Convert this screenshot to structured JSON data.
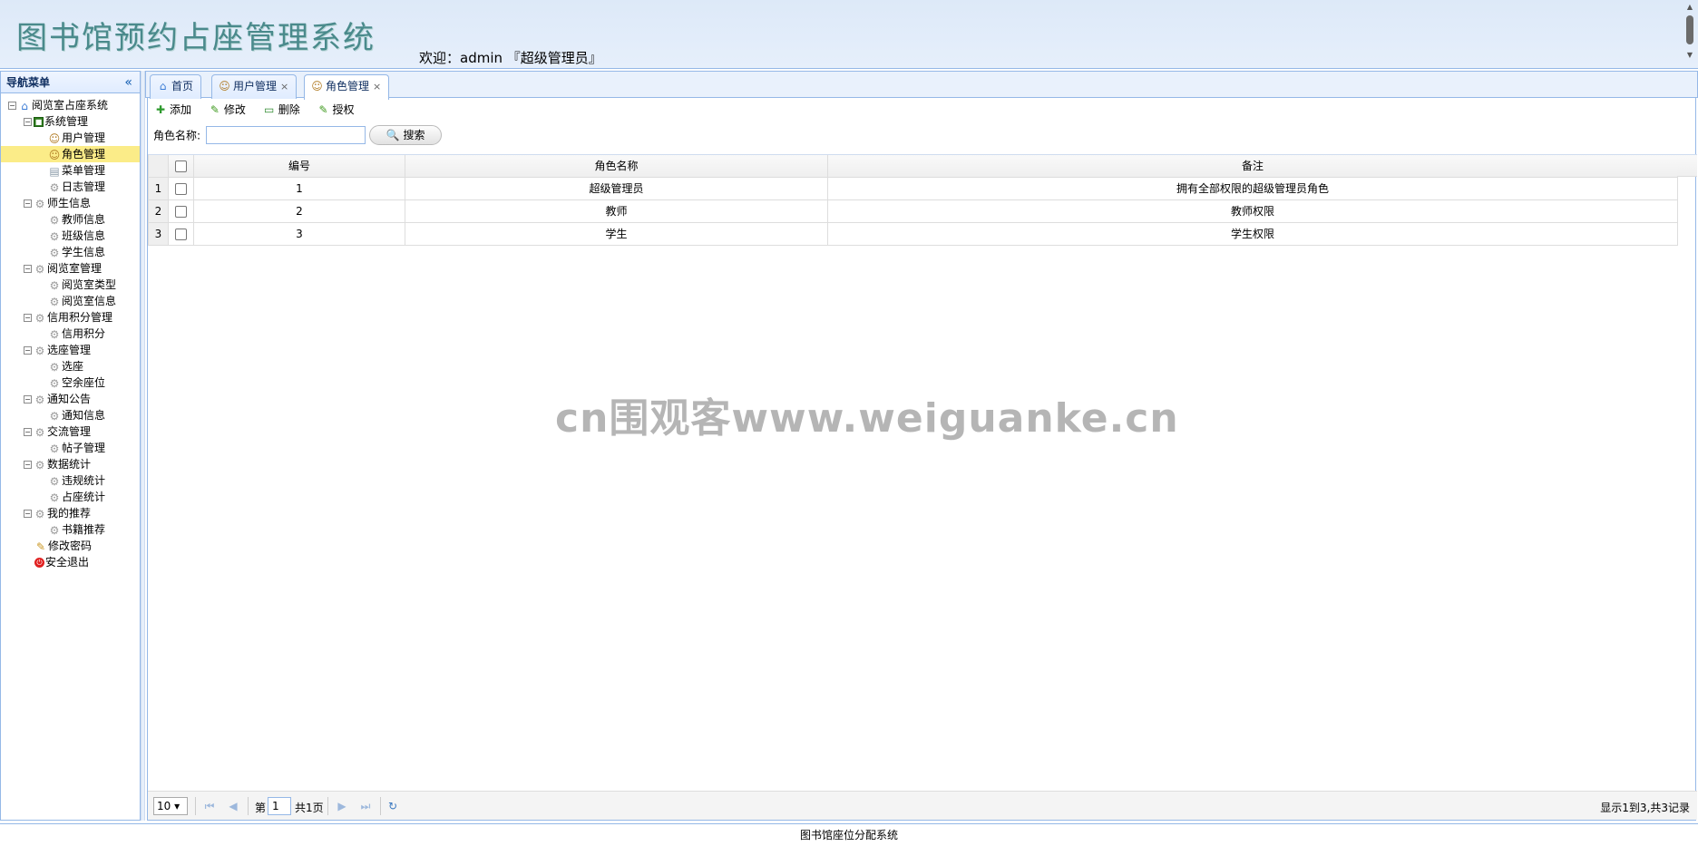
{
  "header": {
    "title": "图书馆预约占座管理系统",
    "welcome": "欢迎：admin 『超级管理员』"
  },
  "sidebar": {
    "title": "导航菜单",
    "tree": {
      "root": "阅览室占座系统",
      "groups": [
        {
          "label": "系统管理",
          "items": [
            "用户管理",
            "角色管理",
            "菜单管理",
            "日志管理"
          ]
        },
        {
          "label": "师生信息",
          "items": [
            "教师信息",
            "班级信息",
            "学生信息"
          ]
        },
        {
          "label": "阅览室管理",
          "items": [
            "阅览室类型",
            "阅览室信息"
          ]
        },
        {
          "label": "信用积分管理",
          "items": [
            "信用积分"
          ]
        },
        {
          "label": "选座管理",
          "items": [
            "选座",
            "空余座位"
          ]
        },
        {
          "label": "通知公告",
          "items": [
            "通知信息"
          ]
        },
        {
          "label": "交流管理",
          "items": [
            "帖子管理"
          ]
        },
        {
          "label": "数据统计",
          "items": [
            "违规统计",
            "占座统计"
          ]
        },
        {
          "label": "我的推荐",
          "items": [
            "书籍推荐"
          ]
        }
      ],
      "leaves": [
        "修改密码",
        "安全退出"
      ],
      "selected": "角色管理"
    }
  },
  "tabs": [
    {
      "label": "首页",
      "closable": false
    },
    {
      "label": "用户管理",
      "closable": true
    },
    {
      "label": "角色管理",
      "closable": true,
      "active": true
    }
  ],
  "toolbar": {
    "add": "添加",
    "edit": "修改",
    "delete": "删除",
    "authorize": "授权"
  },
  "search": {
    "label": "角色名称:",
    "value": "",
    "button": "搜索"
  },
  "grid": {
    "columns": [
      "编号",
      "角色名称",
      "备注"
    ],
    "rows": [
      {
        "rn": "1",
        "id": "1",
        "name": "超级管理员",
        "remark": "拥有全部权限的超级管理员角色"
      },
      {
        "rn": "2",
        "id": "2",
        "name": "教师",
        "remark": "教师权限"
      },
      {
        "rn": "3",
        "id": "3",
        "name": "学生",
        "remark": "学生权限"
      }
    ]
  },
  "pager": {
    "page_size": "10",
    "page_prefix": "第",
    "page_value": "1",
    "page_suffix": "共1页",
    "info": "显示1到3,共3记录"
  },
  "footer": "图书馆座位分配系统",
  "watermark": "cn围观客www.weiguanke.cn",
  "colors": {
    "border": "#95b8e7",
    "selected": "#fbec88",
    "header_bg": "#dde9f8"
  }
}
